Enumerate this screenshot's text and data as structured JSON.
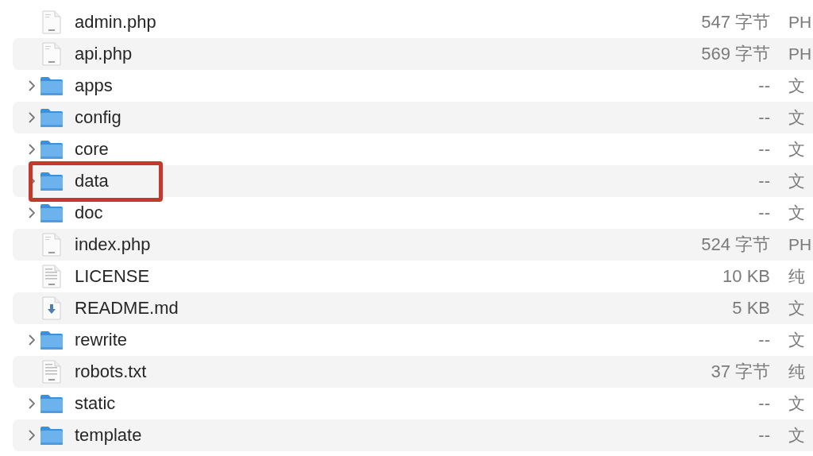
{
  "files": [
    {
      "kind": "php",
      "name": "admin.php",
      "size": "547 字节",
      "type": "PH",
      "highlighted": false
    },
    {
      "kind": "php",
      "name": "api.php",
      "size": "569 字节",
      "type": "PH",
      "highlighted": false
    },
    {
      "kind": "folder",
      "name": "apps",
      "size": "--",
      "type": "文",
      "highlighted": false
    },
    {
      "kind": "folder",
      "name": "config",
      "size": "--",
      "type": "文",
      "highlighted": false
    },
    {
      "kind": "folder",
      "name": "core",
      "size": "--",
      "type": "文",
      "highlighted": false
    },
    {
      "kind": "folder",
      "name": "data",
      "size": "--",
      "type": "文",
      "highlighted": true
    },
    {
      "kind": "folder",
      "name": "doc",
      "size": "--",
      "type": "文",
      "highlighted": false
    },
    {
      "kind": "php",
      "name": "index.php",
      "size": "524 字节",
      "type": "PH",
      "highlighted": false
    },
    {
      "kind": "text",
      "name": "LICENSE",
      "size": "10 KB",
      "type": "纯",
      "highlighted": false
    },
    {
      "kind": "markdown",
      "name": "README.md",
      "size": "5 KB",
      "type": "文",
      "highlighted": false
    },
    {
      "kind": "folder",
      "name": "rewrite",
      "size": "--",
      "type": "文",
      "highlighted": false
    },
    {
      "kind": "text",
      "name": "robots.txt",
      "size": "37 字节",
      "type": "纯",
      "highlighted": false
    },
    {
      "kind": "folder",
      "name": "static",
      "size": "--",
      "type": "文",
      "highlighted": false
    },
    {
      "kind": "folder",
      "name": "template",
      "size": "--",
      "type": "文",
      "highlighted": false
    }
  ]
}
